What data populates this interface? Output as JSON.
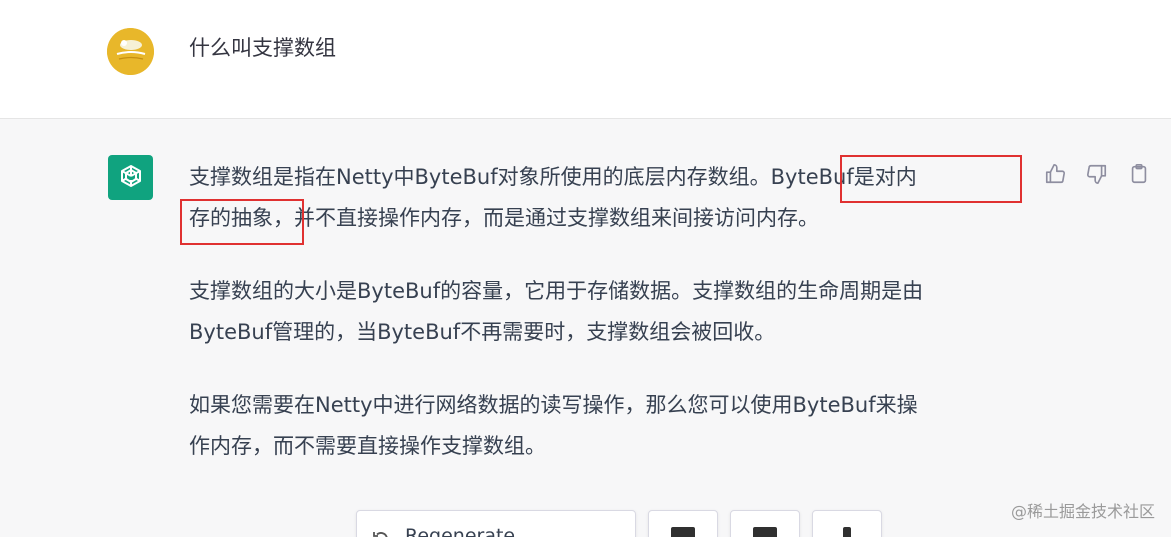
{
  "user": {
    "question": "什么叫支撑数组",
    "avatar_text": "(avatar)"
  },
  "assistant": {
    "p1_a": "支撑数组是指在Netty中ByteBuf对象所使用的底层内存数组。",
    "p1_b": "ByteBuf是对内",
    "p1_c": "存的抽象，",
    "p1_d": "并不直接操作内存，而是通过支撑数组来间接访问内存。",
    "p2_line1": "支撑数组的大小是ByteBuf的容量，它用于存储数据。支撑数组的生命周期是由",
    "p2_line2": "ByteBuf管理的，当ByteBuf不再需要时，支撑数组会被回收。",
    "p3_line1": "如果您需要在Netty中进行网络数据的读写操作，那么您可以使用ByteBuf来操",
    "p3_line2": "作内存，而不需要直接操作支撑数组。"
  },
  "actions": {
    "thumbs_up": "thumbs-up-icon",
    "thumbs_down": "thumbs-down-icon",
    "copy": "copy-icon"
  },
  "bottom": {
    "regenerate_label": "Regenerate"
  },
  "watermark": "@稀土掘金技术社区",
  "colors": {
    "highlight": "#e03131",
    "gpt_green": "#10a37f",
    "user_avatar": "#e8b72a"
  }
}
